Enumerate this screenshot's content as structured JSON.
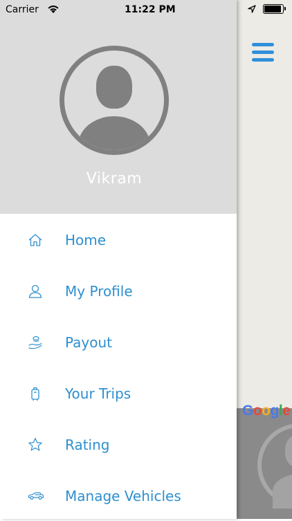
{
  "status_bar": {
    "carrier": "Carrier",
    "time": "11:22 PM",
    "wifi_icon": "wifi-icon",
    "location_icon": "location-arrow-icon",
    "battery_icon": "battery-icon"
  },
  "drawer": {
    "user_name": "Vikram",
    "avatar_icon": "user-avatar-icon",
    "header_color": "#dcdcdc",
    "menu": [
      {
        "label": "Home",
        "icon": "home-icon"
      },
      {
        "label": "My Profile",
        "icon": "user-icon"
      },
      {
        "label": "Payout",
        "icon": "payout-hand-icon"
      },
      {
        "label": "Your Trips",
        "icon": "luggage-icon"
      },
      {
        "label": "Rating",
        "icon": "star-icon"
      },
      {
        "label": "Manage Vehicles",
        "icon": "car-icon"
      }
    ],
    "accent_color": "#2e8fcf"
  },
  "map": {
    "menu_button_icon": "hamburger-menu-icon",
    "attribution": "Google"
  }
}
